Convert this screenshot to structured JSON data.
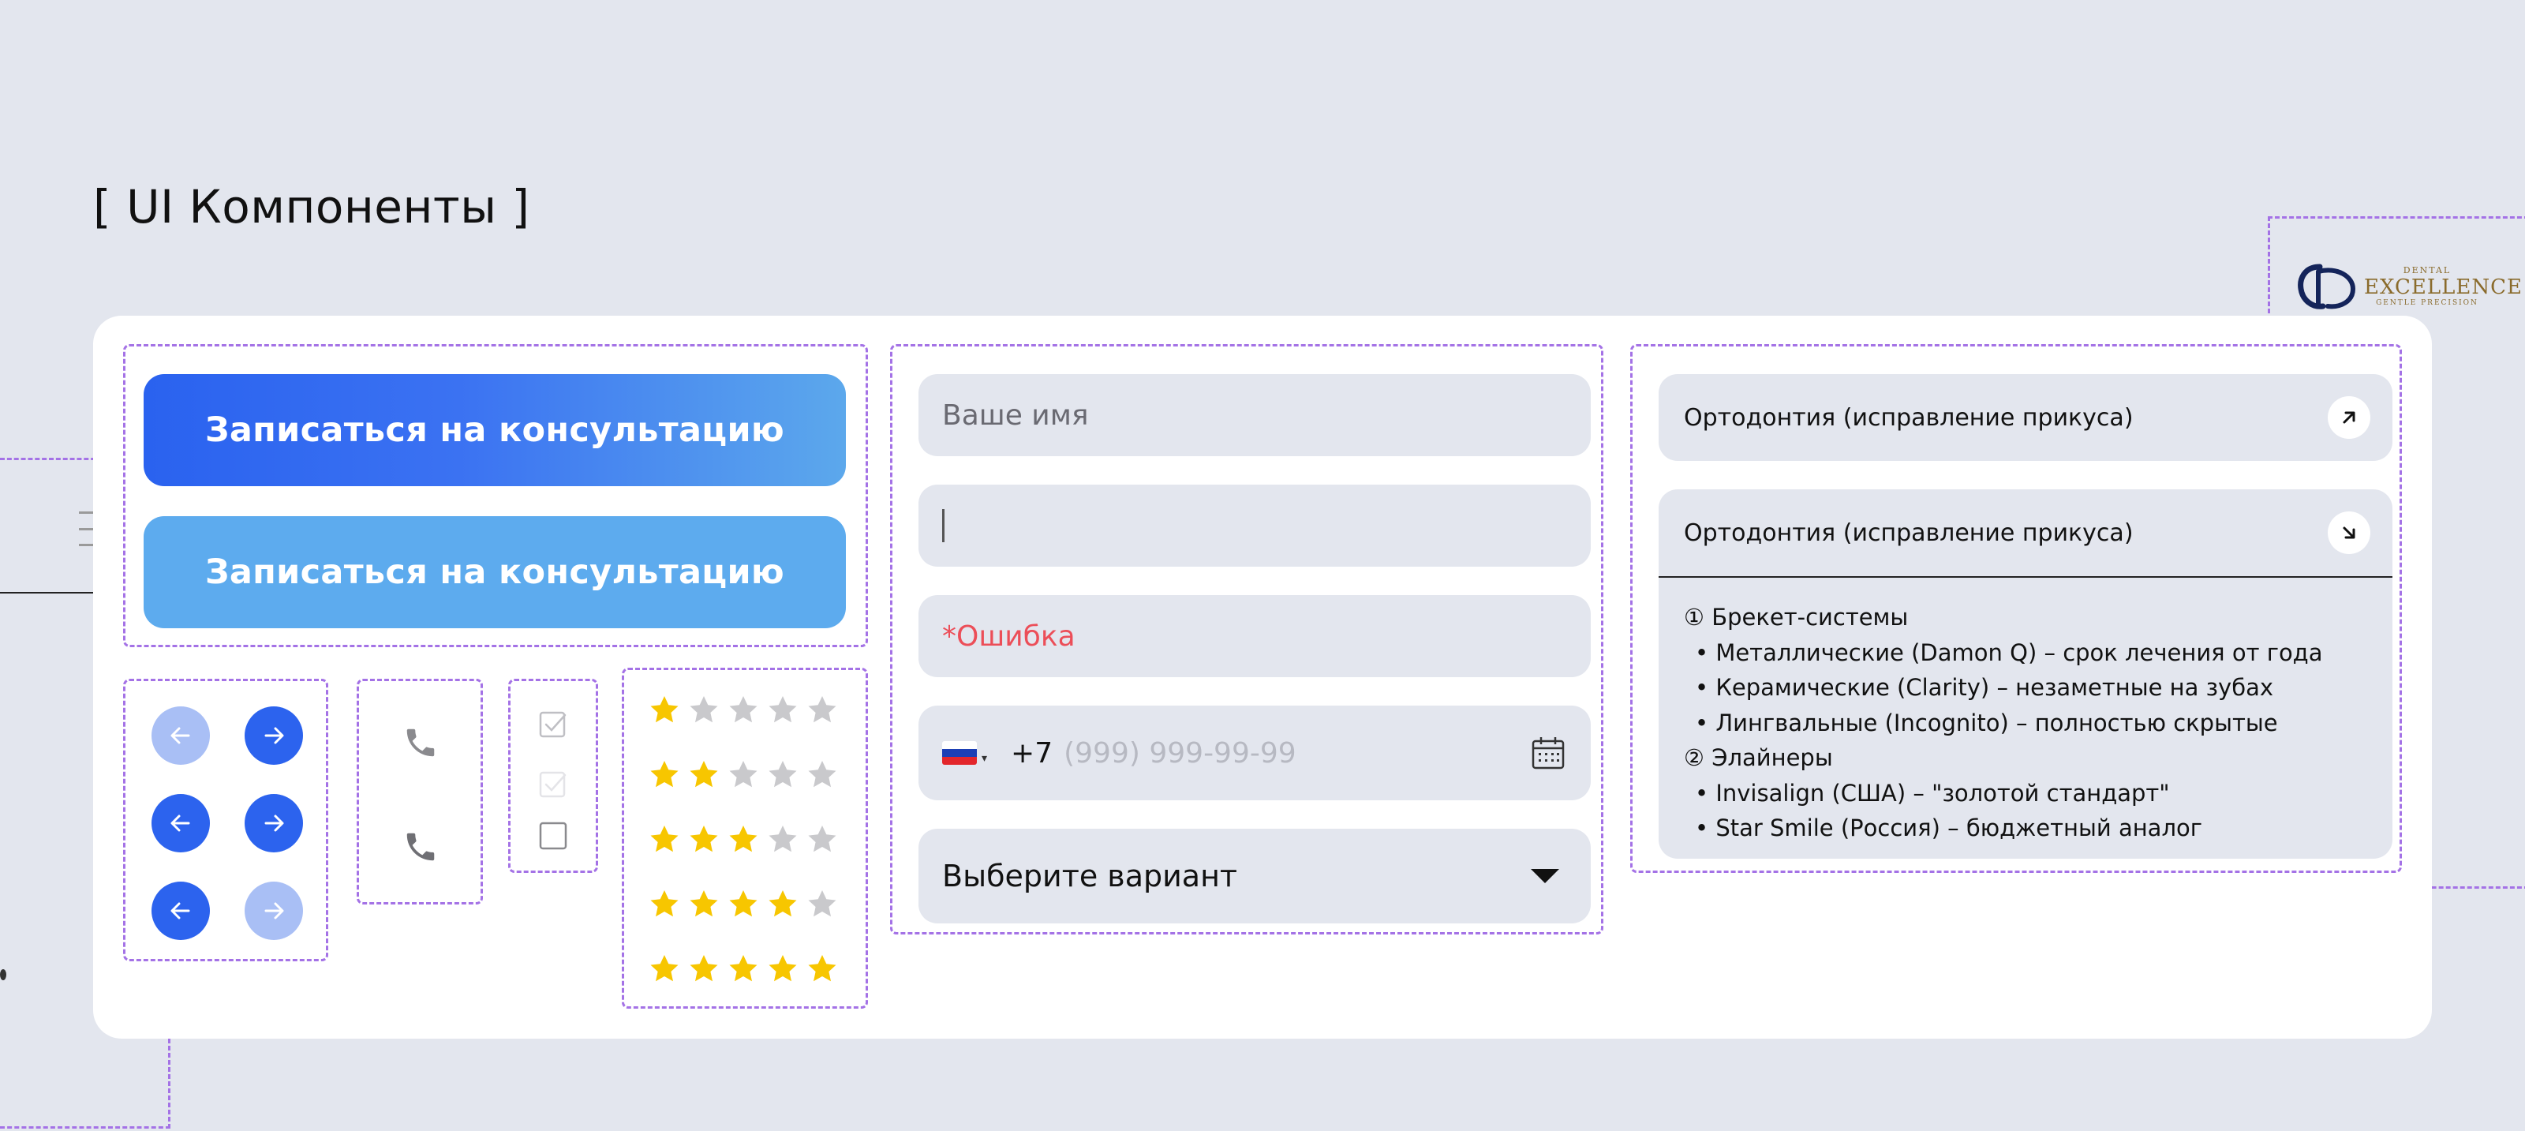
{
  "page": {
    "title": "[ UI Компоненты ]"
  },
  "logo": {
    "small": "DENTAL",
    "big": "EXCELLENCE",
    "tiny": "GENTLE PRECISION"
  },
  "buttons": {
    "primary_label": "Записаться на консультацию",
    "secondary_label": "Записаться на консультацию"
  },
  "arrows": [
    {
      "direction": "left",
      "state": "disabled"
    },
    {
      "direction": "right",
      "state": "active"
    },
    {
      "direction": "left",
      "state": "active"
    },
    {
      "direction": "right",
      "state": "active"
    },
    {
      "direction": "left",
      "state": "active"
    },
    {
      "direction": "right",
      "state": "disabled"
    }
  ],
  "ratings": [
    1,
    2,
    3,
    4,
    5
  ],
  "form": {
    "name_placeholder": "Ваше имя",
    "error_text": "*Ошибка",
    "phone_code": "+7",
    "phone_placeholder": "(999) 999-99-99",
    "select_value": "Выберите вариант"
  },
  "accordion": {
    "item1_title": "Ортодонтия (исправление прикуса)",
    "item2_title": "Ортодонтия (исправление прикуса)",
    "item2_lines": [
      "① Брекет-системы",
      "•  Металлические (Damon Q) – срок лечения от года",
      "•  Керамические (Clarity) – незаметные на зубах",
      "•  Лингвальные (Incognito) – полностью скрытые",
      "② Элайнеры",
      "•  Invisalign (США) – \"золотой стандарт\"",
      "•  Star Smile (Россия) – бюджетный аналог"
    ]
  },
  "colors": {
    "background": "#e3e6ee",
    "card": "#ffffff",
    "accent_blue": "#2c63ee",
    "light_blue": "#5dabee",
    "dashed_frame": "#a472e6",
    "star_filled": "#f7c600",
    "star_empty": "#c9c9cc",
    "error": "#ec4e58"
  }
}
